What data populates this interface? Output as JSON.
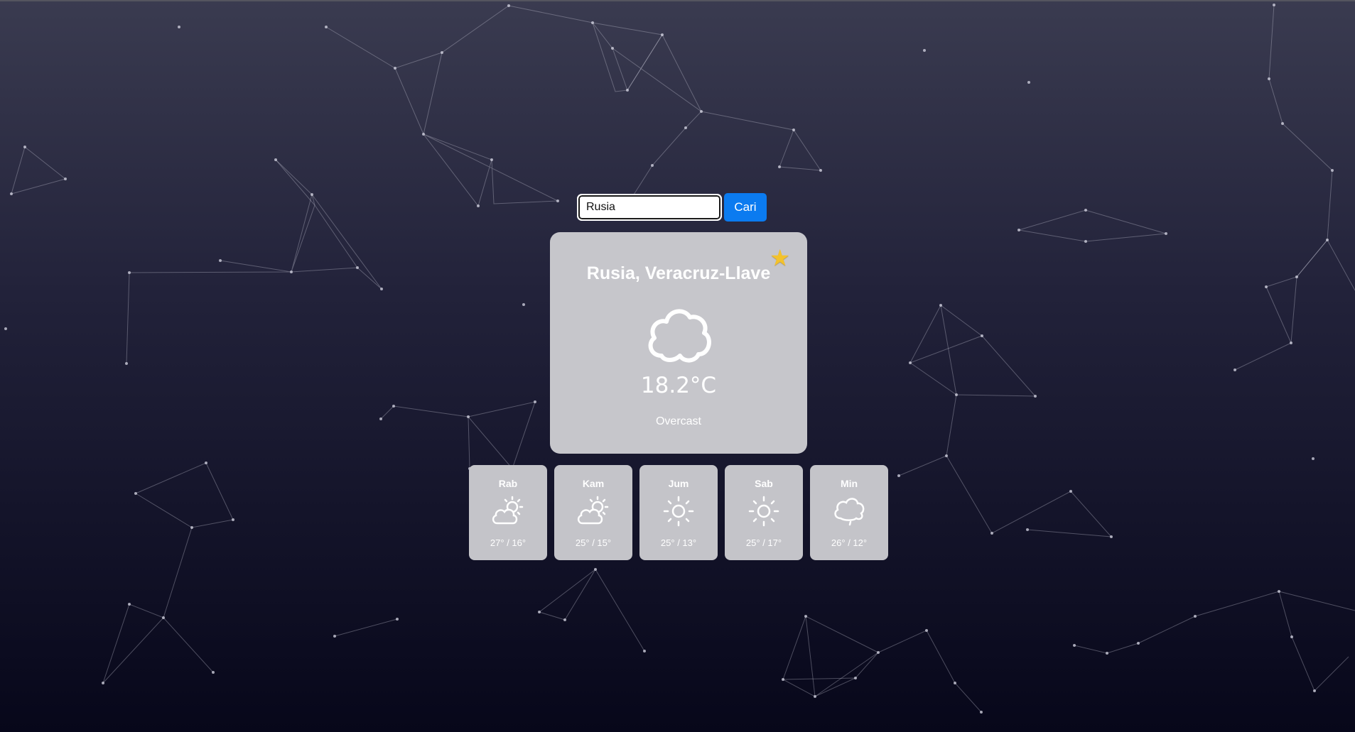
{
  "search": {
    "value": "Rusia",
    "button_label": "Cari"
  },
  "current": {
    "location": "Rusia, Veracruz-Llave",
    "temperature": "18.2°C",
    "condition": "Overcast",
    "icon": "cloud-icon",
    "favorite_icon": "star-icon",
    "favorite_color": "#f3c22b"
  },
  "forecast": [
    {
      "day": "Rab",
      "temp": "27° / 16°",
      "icon": "partly-cloudy-icon"
    },
    {
      "day": "Kam",
      "temp": "25° / 15°",
      "icon": "partly-cloudy-icon"
    },
    {
      "day": "Jum",
      "temp": "25° / 13°",
      "icon": "sun-icon"
    },
    {
      "day": "Sab",
      "temp": "25° / 17°",
      "icon": "sun-icon"
    },
    {
      "day": "Min",
      "temp": "26° / 12°",
      "icon": "cloud-drizzle-icon"
    }
  ],
  "colors": {
    "accent": "#0b7bf0",
    "card": "#c6c6cb",
    "background_top": "#3a3b50",
    "background_bottom": "#07071a"
  }
}
